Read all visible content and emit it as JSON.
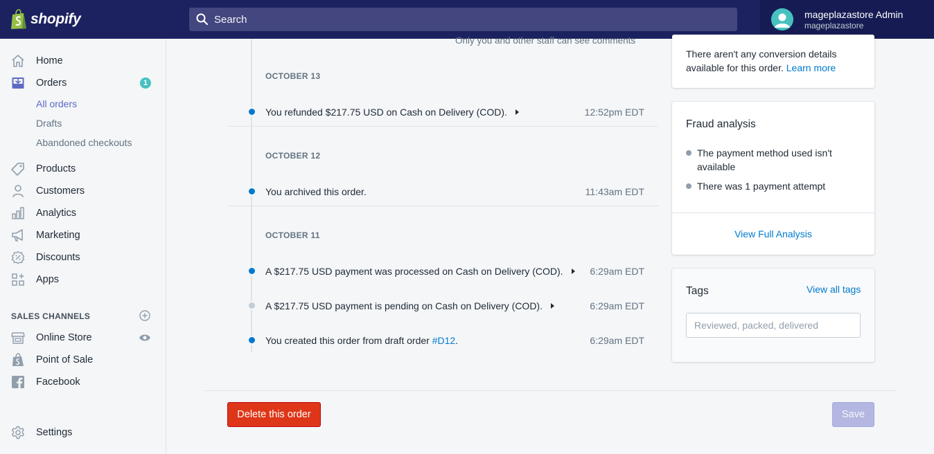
{
  "header": {
    "brand": "shopify",
    "search_placeholder": "Search",
    "user_name": "mageplazastore Admin",
    "user_store": "mageplazastore"
  },
  "sidebar": {
    "items": [
      {
        "label": "Home",
        "icon": "home-icon"
      },
      {
        "label": "Orders",
        "icon": "orders-icon",
        "badge": "1"
      },
      {
        "label": "Products",
        "icon": "tag-icon"
      },
      {
        "label": "Customers",
        "icon": "customer-icon"
      },
      {
        "label": "Analytics",
        "icon": "analytics-icon"
      },
      {
        "label": "Marketing",
        "icon": "megaphone-icon"
      },
      {
        "label": "Discounts",
        "icon": "discount-icon"
      },
      {
        "label": "Apps",
        "icon": "apps-icon"
      }
    ],
    "orders_sub": [
      "All orders",
      "Drafts",
      "Abandoned checkouts"
    ],
    "sales_channels_title": "SALES CHANNELS",
    "channels": [
      {
        "label": "Online Store",
        "icon": "store-icon"
      },
      {
        "label": "Point of Sale",
        "icon": "pos-bag-icon"
      },
      {
        "label": "Facebook",
        "icon": "facebook-icon"
      }
    ],
    "settings_label": "Settings"
  },
  "timeline": {
    "comment_note": "Only you and other staff can see comments",
    "groups": [
      {
        "date": "OCTOBER 13",
        "events": [
          {
            "text": "You refunded $217.75 USD on Cash on Delivery (COD).",
            "time": "12:52pm EDT",
            "expandable": true,
            "status": "done"
          }
        ]
      },
      {
        "date": "OCTOBER 12",
        "events": [
          {
            "text": "You archived this order.",
            "time": "11:43am EDT",
            "expandable": false,
            "status": "done"
          }
        ]
      },
      {
        "date": "OCTOBER 11",
        "events": [
          {
            "text": "A $217.75 USD payment was processed on Cash on Delivery (COD).",
            "time": "6:29am EDT",
            "expandable": true,
            "status": "done"
          },
          {
            "text": "A $217.75 USD payment is pending on Cash on Delivery (COD).",
            "time": "6:29am EDT",
            "expandable": true,
            "status": "pending"
          },
          {
            "text": "You created this order from draft order ",
            "link": "#D12",
            "suffix": ".",
            "time": "6:29am EDT",
            "expandable": false,
            "status": "done"
          }
        ]
      }
    ]
  },
  "conversion": {
    "text": "There aren't any conversion details available for this order.",
    "link": "Learn more"
  },
  "fraud": {
    "title": "Fraud analysis",
    "bullets": [
      "The payment method used isn't available",
      "There was 1 payment attempt"
    ],
    "link": "View Full Analysis"
  },
  "tags": {
    "title": "Tags",
    "view_all": "View all tags",
    "placeholder": "Reviewed, packed, delivered"
  },
  "footer": {
    "delete_label": "Delete this order",
    "save_label": "Save"
  },
  "colors": {
    "topbar": "#1c2260",
    "accent": "#5c6ac4",
    "timeline_dot": "#007ace",
    "timeline_dot_pending": "#c4cdd5",
    "danger": "#de3618",
    "badge": "#47c1bf"
  }
}
